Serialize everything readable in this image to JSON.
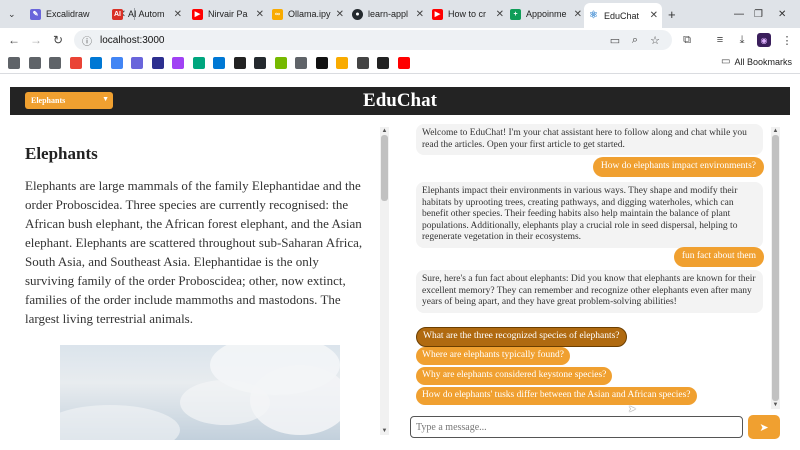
{
  "browser": {
    "tabs": [
      {
        "title": "Excalidraw",
        "icon": "excalidraw-icon",
        "color": "#6965db",
        "active": false
      },
      {
        "title": "AI Autom",
        "icon": "ai-icon",
        "color": "#d93025",
        "active": false
      },
      {
        "title": "Nirvair Pa",
        "icon": "youtube-icon",
        "color": "#ff0000",
        "active": false
      },
      {
        "title": "Ollama.ipy",
        "icon": "colab-icon",
        "color": "#f9ab00",
        "active": false
      },
      {
        "title": "learn-appl",
        "icon": "github-icon",
        "color": "#24292e",
        "active": false
      },
      {
        "title": "How to cr",
        "icon": "youtube-icon",
        "color": "#ff0000",
        "active": false
      },
      {
        "title": "Appoinme",
        "icon": "sheets-icon",
        "color": "#0f9d58",
        "active": false
      },
      {
        "title": "EduChat",
        "icon": "react-icon",
        "color": "#61dafb",
        "active": true
      }
    ],
    "new_tab_label": "+",
    "url": "localhost:3000",
    "bookmarks_label": "All Bookmarks",
    "bookmark_icons": [
      {
        "name": "folder",
        "color": "#5f6368"
      },
      {
        "name": "folder",
        "color": "#5f6368"
      },
      {
        "name": "folder",
        "color": "#5f6368"
      },
      {
        "name": "gmail",
        "color": "#ea4335"
      },
      {
        "name": "azure",
        "color": "#0078d4"
      },
      {
        "name": "google",
        "color": "#4285f4"
      },
      {
        "name": "excalidraw",
        "color": "#6965db"
      },
      {
        "name": "notion",
        "color": "#2d2f8f"
      },
      {
        "name": "box",
        "color": "#a142f4"
      },
      {
        "name": "r",
        "color": "#00a67e"
      },
      {
        "name": "a",
        "color": "#0078d4"
      },
      {
        "name": "triangle",
        "color": "#222222"
      },
      {
        "name": "github",
        "color": "#24292e"
      },
      {
        "name": "nvidia",
        "color": "#76b900"
      },
      {
        "name": "cloud",
        "color": "#5f6368"
      },
      {
        "name": "p",
        "color": "#111111"
      },
      {
        "name": "colab",
        "color": "#f9ab00"
      },
      {
        "name": "box2",
        "color": "#444444"
      },
      {
        "name": "openai",
        "color": "#222222"
      },
      {
        "name": "youtube",
        "color": "#ff0000"
      }
    ]
  },
  "app": {
    "title": "EduChat",
    "article_select": "Elephants",
    "accent_color": "#f0a030"
  },
  "article": {
    "title": "Elephants",
    "body": "Elephants are large mammals of the family Elephantidae and the order Proboscidea. Three species are currently recognised: the African bush elephant, the African forest elephant, and the Asian elephant. Elephants are scattered throughout sub-Saharan Africa, South Asia, and Southeast Asia. Elephantidae is the only surviving family of the order Proboscidea; other, now extinct, families of the order include mammoths and mastodons. The largest living terrestrial animals."
  },
  "chat": {
    "messages": [
      {
        "role": "bot",
        "text": "Welcome to EduChat! I'm your chat assistant here to follow along and chat while you read the articles. Open your first article to get started."
      },
      {
        "role": "user",
        "text": "How do elephants impact environments?"
      },
      {
        "role": "bot",
        "text": "Elephants impact their environments in various ways. They shape and modify their habitats by uprooting trees, creating pathways, and digging waterholes, which can benefit other species. Their feeding habits also help maintain the balance of plant populations. Additionally, elephants play a crucial role in seed dispersal, helping to regenerate vegetation in their ecosystems."
      },
      {
        "role": "user",
        "text": "fun fact about them"
      },
      {
        "role": "bot",
        "text": "Sure, here's a fun fact about elephants: Did you know that elephants are known for their excellent memory? They can remember and recognize other elephants even after many years of being apart, and they have great problem-solving abilities!"
      }
    ],
    "suggestions": [
      "What are the three recognized species of elephants?",
      "Where are elephants typically found?",
      "Why are elephants considered keystone species?",
      "How do elephants' tusks differ between the Asian and African species?"
    ],
    "input_placeholder": "Type a message..."
  }
}
